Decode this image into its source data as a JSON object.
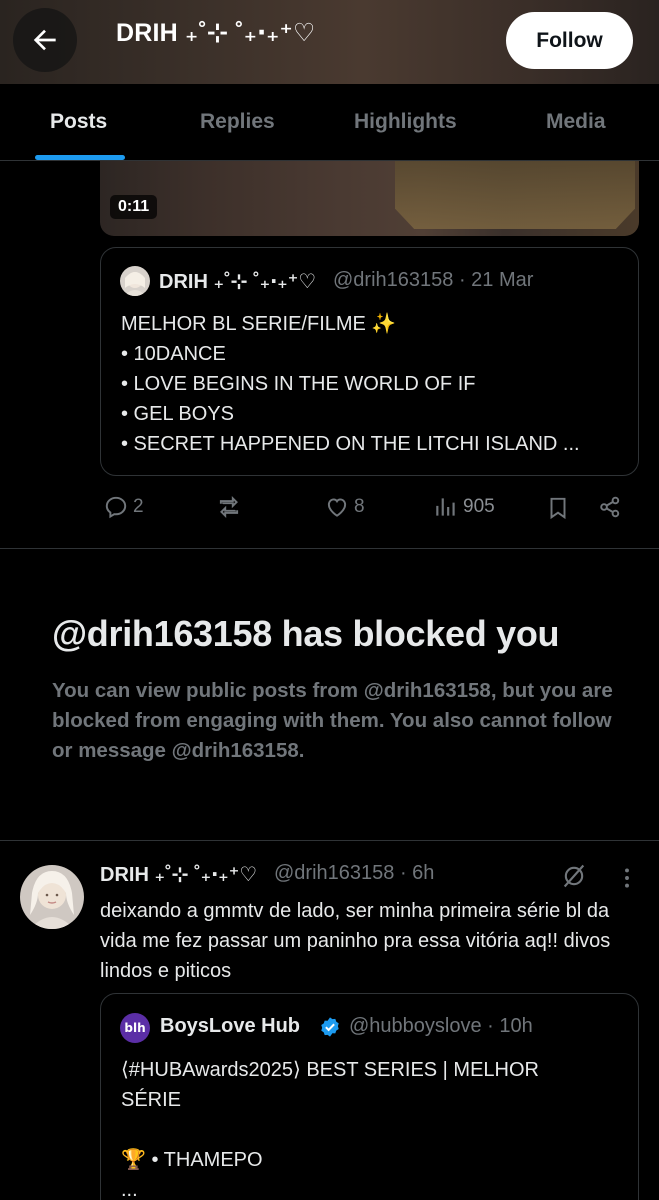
{
  "header": {
    "title": "DRIH ₊˚⊹ ˚₊‧₊⁺♡",
    "follow_label": "Follow"
  },
  "tabs": [
    "Posts",
    "Replies",
    "Highlights",
    "Media"
  ],
  "video": {
    "duration": "0:11"
  },
  "quote1": {
    "name": "DRIH ₊˚⊹ ˚₊‧₊⁺♡",
    "handle_time": "@drih163158 · 21 Mar",
    "lines": [
      "MELHOR BL SERIE/FILME ✨",
      "• 10DANCE",
      "• LOVE BEGINS IN THE WORLD OF IF",
      "• GEL BOYS",
      "• SECRET HAPPENED ON THE LITCHI ISLAND ..."
    ]
  },
  "actions": {
    "replies": "2",
    "reposts": "",
    "likes": "8",
    "views": "905"
  },
  "blocked": {
    "title": "@drih163158 has blocked you",
    "body": "You can view public posts from @drih163158, but you are blocked from engaging with them. You also cannot follow or message @drih163158."
  },
  "post2": {
    "name": "DRIH ₊˚⊹ ˚₊‧₊⁺♡",
    "handle_time": "@drih163158 · 6h",
    "text": "deixando a gmmtv de lado, ser minha primeira série bl da vida me fez passar um paninho pra essa vitória aq!! divos lindos e piticos"
  },
  "quote2": {
    "name": "BoysLove Hub",
    "avatar_text": "blh",
    "handle_time": "@hubboyslove · 10h",
    "lines": [
      "⟨#HUBAwards2025⟩ BEST SERIES | MELHOR",
      "SÉRIE",
      "",
      "🏆 • THAMEPO",
      "..."
    ]
  },
  "colors": {
    "accent": "#1d9bf0",
    "muted": "#71767b",
    "text": "#e7e9ea",
    "border": "#2f3336",
    "verified": "#1d9bf0"
  }
}
